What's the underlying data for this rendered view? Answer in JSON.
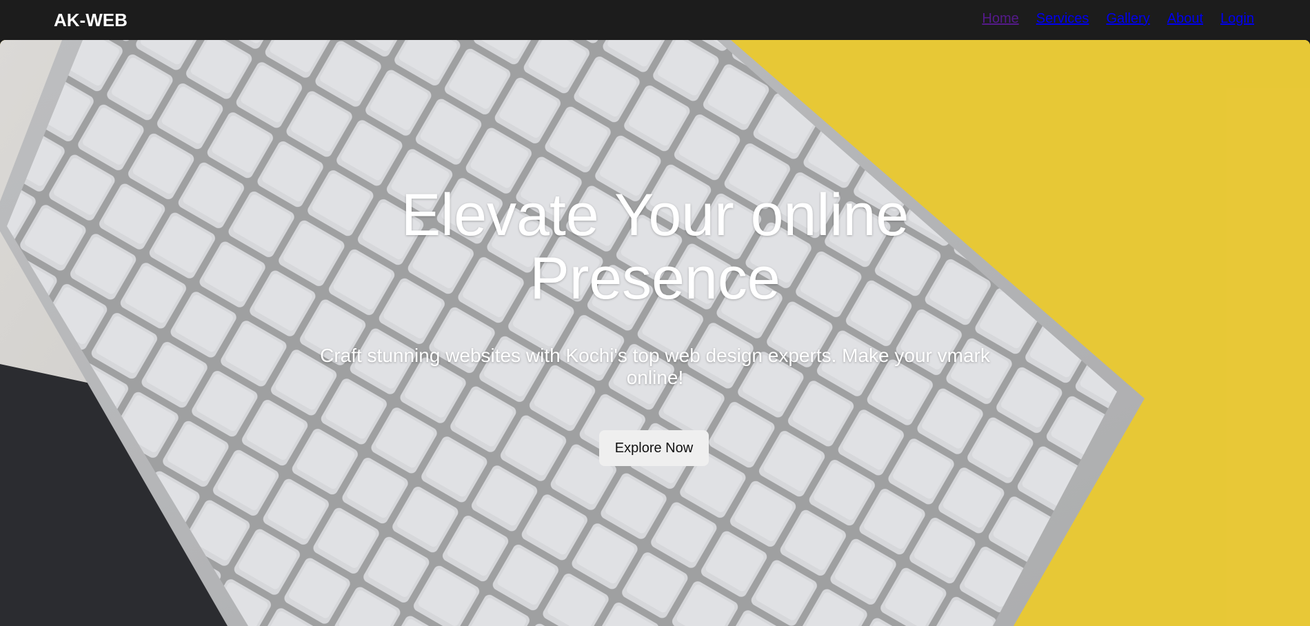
{
  "brand": {
    "logo": "AK-WEB"
  },
  "nav": {
    "items": [
      {
        "label": "Home",
        "color": "#551a8b"
      },
      {
        "label": "Services",
        "color": "#0000ee"
      },
      {
        "label": "Gallery",
        "color": "#0000ee"
      },
      {
        "label": "About",
        "color": "#0000ee"
      },
      {
        "label": "Login",
        "color": "#0000ee"
      }
    ]
  },
  "hero": {
    "title": "Elevate Your online Presence",
    "subtitle": "Craft stunning websites with Kochi's top web design experts. Make your vmark online!",
    "cta_label": "Explore Now",
    "background": "keyboard-on-yellow-photo"
  },
  "colors": {
    "navbar_bg": "#1c1c1c",
    "hero_yellow": "#f6d53a",
    "text_white": "#ffffff",
    "button_bg": "#efefef"
  }
}
